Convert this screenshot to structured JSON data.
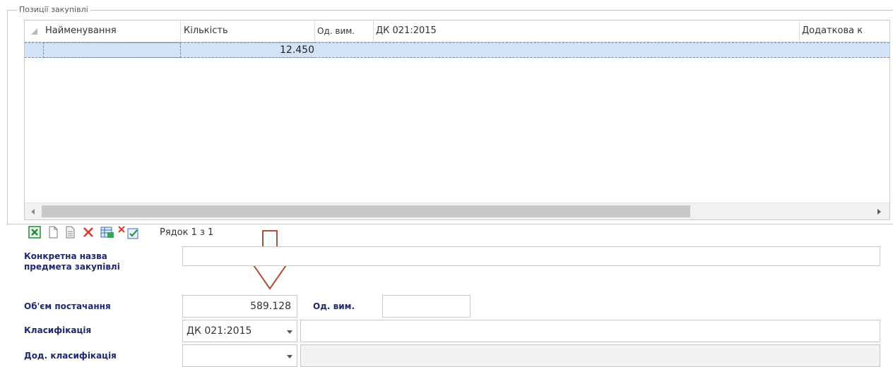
{
  "section_title": "Позиції закупівлі",
  "grid": {
    "columns": [
      "Найменування",
      "Кількість",
      "Од. вим.",
      "ДК 021:2015",
      "Додаткова к"
    ],
    "rows": [
      {
        "name": "",
        "quantity": "12.450",
        "unit": "",
        "dk": "",
        "extra": ""
      }
    ]
  },
  "toolbar": {
    "icons": [
      "excel-export-icon",
      "new-document-icon",
      "copy-document-icon",
      "delete-icon",
      "grid-settings-icon",
      "cancel-check-icon",
      "accept-check-icon"
    ],
    "pager": "Рядок 1 з 1"
  },
  "form": {
    "specific_name_label": "Конкретна назва предмета закупівлі",
    "specific_name_value": "",
    "volume_label": "Об'єм постачання",
    "volume_value": "589.128",
    "unit_label": "Од. вим.",
    "unit_value": "",
    "classification_label": "Класифікація",
    "classification_value": "ДК 021:2015",
    "classification_text": "",
    "extra_classification_label": "Дод. класифікація",
    "extra_classification_value": "",
    "extra_classification_text": ""
  },
  "colors": {
    "selected_row": "#d2e2f7",
    "label_text": "#1f2870",
    "excel_green": "#1f8a3b",
    "delete_red": "#e0352b"
  }
}
